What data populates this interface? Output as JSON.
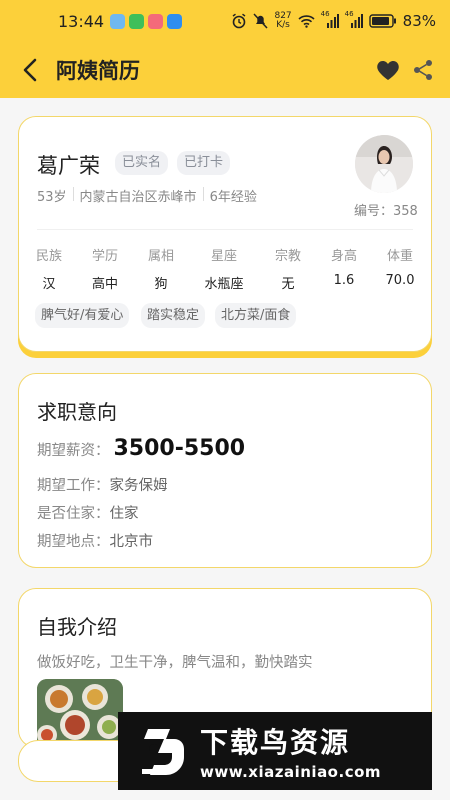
{
  "status": {
    "time": "13:44",
    "net_speed_num": "827",
    "net_speed_unit": "K/s",
    "signal1": "46",
    "signal2": "46",
    "battery": "83%"
  },
  "header": {
    "title": "阿姨简历"
  },
  "profile": {
    "name": "葛广荣",
    "badges": [
      "已实名",
      "已打卡"
    ],
    "age": "53岁",
    "origin": "内蒙古自治区赤峰市",
    "experience": "6年经验",
    "serial": "编号：358",
    "attributes": [
      {
        "label": "民族",
        "value": "汉"
      },
      {
        "label": "学历",
        "value": "高中"
      },
      {
        "label": "属相",
        "value": "狗"
      },
      {
        "label": "星座",
        "value": "水瓶座"
      },
      {
        "label": "宗教",
        "value": "无"
      },
      {
        "label": "身高",
        "value": "1.6"
      },
      {
        "label": "体重",
        "value": "70.0"
      }
    ],
    "tags": [
      "脾气好/有爱心",
      "踏实稳定",
      "北方菜/面食"
    ]
  },
  "job_intent": {
    "title": "求职意向",
    "salary_label": "期望薪资：",
    "salary_value": "3500-5500",
    "job_label": "期望工作：",
    "job_value": "家务保姆",
    "live_in_label": "是否住家：",
    "live_in_value": "住家",
    "location_label": "期望地点：",
    "location_value": "北京市"
  },
  "intro": {
    "title": "自我介绍",
    "text": "做饭好吃，卫生干净，脾气温和，勤快踏实"
  },
  "watermark": {
    "title": "下载鸟资源",
    "url": "www.xiazainiao.com"
  },
  "colors": {
    "accent": "#fcd03a",
    "card_border": "#f3d76a"
  }
}
